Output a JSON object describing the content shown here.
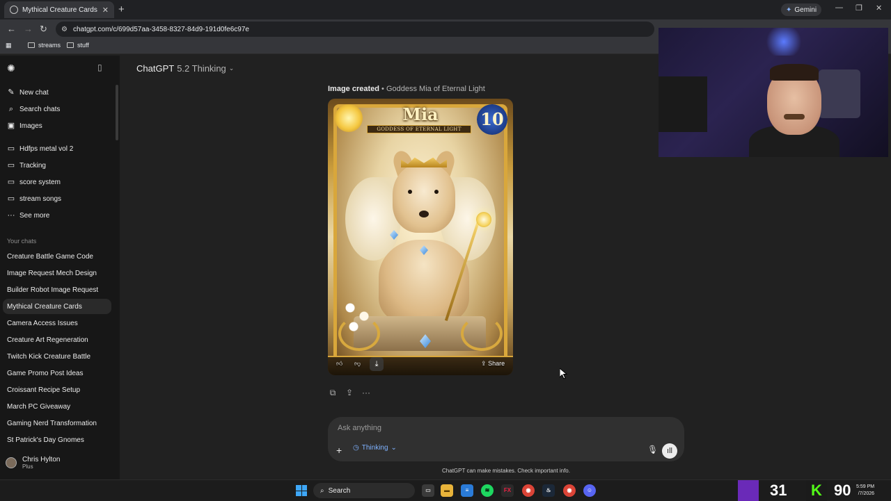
{
  "browser": {
    "tab_title": "Mythical Creature Cards",
    "new_tab": "+",
    "tab_close": "✕",
    "gemini_label": "Gemini",
    "url": "chatgpt.com/c/699d57aa-3458-8327-84d9-191d0fe6c97e",
    "bookmarks": [
      "streams",
      "stuff"
    ]
  },
  "sidebar": {
    "top_items": [
      {
        "label": "New chat",
        "icon": "pencil-icon"
      },
      {
        "label": "Search chats",
        "icon": "search-icon"
      },
      {
        "label": "Images",
        "icon": "image-icon"
      }
    ],
    "projects": [
      {
        "label": "Hdfps metal vol 2",
        "icon": "folder-icon"
      },
      {
        "label": "Tracking",
        "icon": "folder-icon"
      },
      {
        "label": "score system",
        "icon": "folder-icon"
      },
      {
        "label": "stream songs",
        "icon": "folder-icon"
      },
      {
        "label": "See more",
        "icon": "more-icon"
      }
    ],
    "section_title": "Your chats",
    "chats": [
      "Creature Battle Game Code",
      "Image Request Mech Design",
      "Builder Robot Image Request",
      "Mythical Creature Cards",
      "Camera Access Issues",
      "Creature Art Regeneration",
      "Twitch Kick Creature Battle",
      "Game Promo Post Ideas",
      "Croissant Recipe Setup",
      "March PC Giveaway",
      "Gaming Nerd Transformation",
      "St Patrick's Day Gnomes"
    ],
    "active_chat": "Mythical Creature Cards",
    "user": {
      "name": "Chris Hylton",
      "plan": "Plus"
    }
  },
  "header": {
    "model_name": "ChatGPT",
    "model_version": "5.2 Thinking"
  },
  "message": {
    "caption_prefix": "Image created",
    "caption_separator": " • ",
    "caption_title": "Goddess Mia of Eternal Light",
    "card": {
      "name": "Mia",
      "subtitle": "GODDESS OF ETERNAL LIGHT",
      "level": "10"
    },
    "share_label": "Share"
  },
  "composer": {
    "placeholder": "Ask anything",
    "mode_label": "Thinking"
  },
  "disclaimer": "ChatGPT can make mistakes. Check important info.",
  "taskbar": {
    "search_label": "Search",
    "counter_left": "31",
    "counter_right": "90",
    "time": "5:59 PM",
    "date": "/7/2026"
  }
}
